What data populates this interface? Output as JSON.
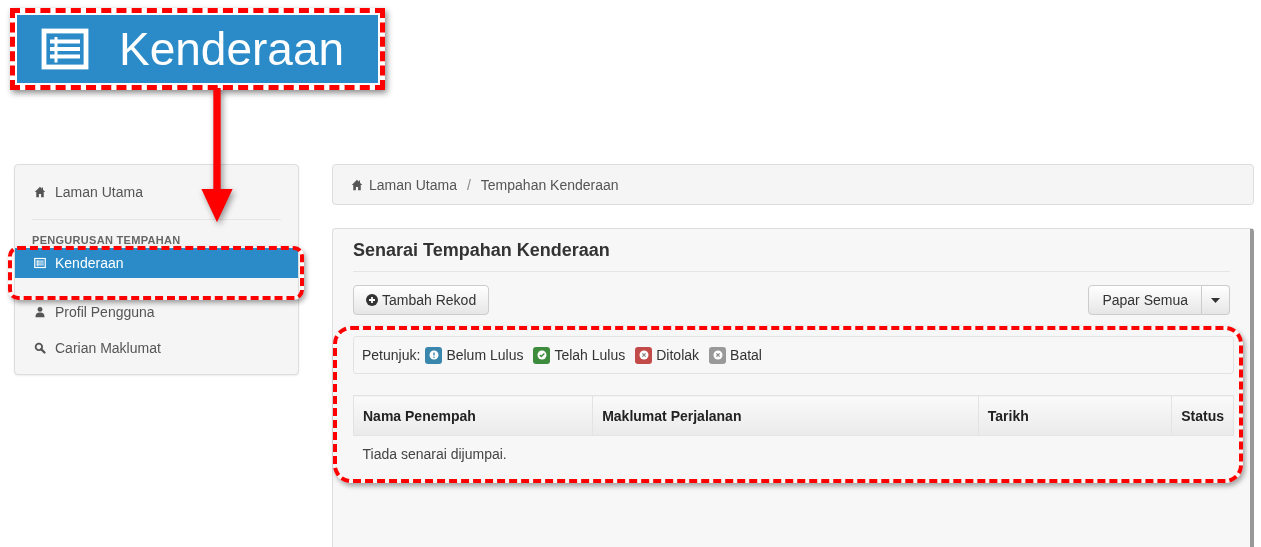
{
  "callout": {
    "label": "Kenderaan"
  },
  "sidebar": {
    "items": [
      {
        "kind": "link",
        "label": "Laman Utama",
        "selected": false
      },
      {
        "kind": "heading",
        "label": "PENGURUSAN TEMPAHAN"
      },
      {
        "kind": "link",
        "label": "Kenderaan",
        "selected": true
      },
      {
        "kind": "link",
        "label": "Profil Pengguna",
        "selected": false
      },
      {
        "kind": "link",
        "label": "Carian Maklumat",
        "selected": false
      }
    ]
  },
  "breadcrumb": {
    "items": [
      "Laman Utama",
      "Tempahan Kenderaan"
    ],
    "separator": "/"
  },
  "panel": {
    "title": "Senarai Tempahan Kenderaan",
    "add_button": "Tambah Rekod",
    "filter_button": "Papar Semua",
    "legend": {
      "label": "Petunjuk:",
      "items": [
        {
          "kind": "info",
          "label": "Belum Lulus",
          "color": "#3a87ad"
        },
        {
          "kind": "check",
          "label": "Telah Lulus",
          "color": "#3d8b3d"
        },
        {
          "kind": "times",
          "label": "Ditolak",
          "color": "#c24a48"
        },
        {
          "kind": "times",
          "label": "Batal",
          "color": "#999999"
        }
      ]
    },
    "table": {
      "columns": [
        "Nama Penempah",
        "Maklumat Perjalanan",
        "Tarikh",
        "Status"
      ],
      "empty_message": "Tiada senarai dijumpai."
    }
  }
}
